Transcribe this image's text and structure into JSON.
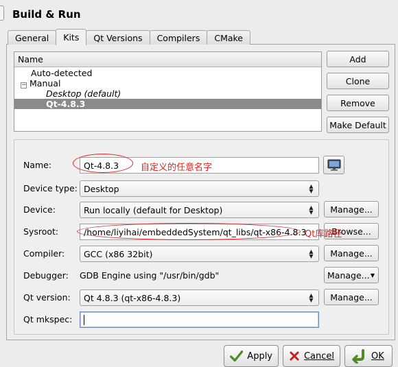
{
  "header": {
    "title": "Build & Run"
  },
  "tabs": [
    {
      "label": "General"
    },
    {
      "label": "Kits"
    },
    {
      "label": "Qt Versions"
    },
    {
      "label": "Compilers"
    },
    {
      "label": "CMake"
    }
  ],
  "kits_tree": {
    "column_header": "Name",
    "rows": [
      {
        "label": "Auto-detected"
      },
      {
        "label": "Manual"
      },
      {
        "label": "Desktop (default)"
      },
      {
        "label": "Qt-4.8.3"
      }
    ]
  },
  "kit_buttons": {
    "add": "Add",
    "clone": "Clone",
    "remove": "Remove",
    "make_default": "Make Default"
  },
  "form": {
    "name": {
      "label": "Name:",
      "value": "Qt-4.8.3"
    },
    "device_type": {
      "label": "Device type:",
      "value": "Desktop"
    },
    "device": {
      "label": "Device:",
      "value": "Run locally (default for Desktop)",
      "button": "Manage..."
    },
    "sysroot": {
      "label": "Sysroot:",
      "value": "/home/liyihai/embeddedSystem/qt_libs/qt-x86-4.8.3",
      "button": "Browse..."
    },
    "compiler": {
      "label": "Compiler:",
      "value": "GCC (x86 32bit)",
      "button": "Manage..."
    },
    "debugger": {
      "label": "Debugger:",
      "value": "GDB Engine using \"/usr/bin/gdb\"",
      "button": "Manage..."
    },
    "qt_version": {
      "label": "Qt version:",
      "value": "Qt 4.8.3 (qt-x86-4.8.3)",
      "button": "Manage..."
    },
    "qt_mkspec": {
      "label": "Qt mkspec:",
      "value": ""
    }
  },
  "annotations": {
    "name_note": "自定义的任意名字",
    "sysroot_note": "Qt库路径",
    "color": "#e0211b"
  },
  "footer": {
    "apply": "Apply",
    "cancel": "Cancel",
    "ok": "OK"
  },
  "icons": {
    "device": "monitor-icon",
    "apply": "checkmark-icon",
    "cancel": "x-icon",
    "ok": "arrow-icon"
  }
}
